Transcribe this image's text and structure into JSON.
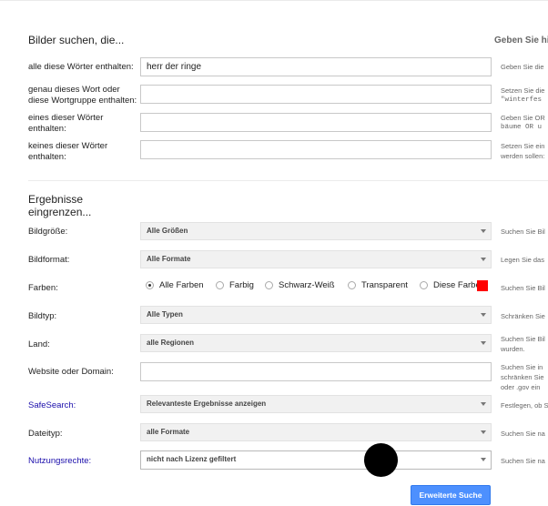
{
  "section_find": {
    "title": "Bilder suchen, die...",
    "hint_header": "Geben Sie hi",
    "rows": [
      {
        "label": "alle diese Wörter enthalten:",
        "value": "herr der ringe",
        "hint_lines": [
          "Geben Sie die"
        ]
      },
      {
        "label": "genau dieses Wort oder diese Wortgruppe enthalten:",
        "value": "",
        "hint_lines": [
          "Setzen Sie die",
          "\"winterfes"
        ]
      },
      {
        "label": "eines dieser Wörter enthalten:",
        "value": "",
        "hint_lines": [
          "Geben Sie OR",
          "bäume OR u"
        ]
      },
      {
        "label": "keines dieser Wörter enthalten:",
        "value": "",
        "hint_lines": [
          "Setzen Sie ein",
          "werden sollen:"
        ]
      }
    ]
  },
  "section_narrow": {
    "title": "Ergebnisse eingrenzen...",
    "bildgroesse": {
      "label": "Bildgröße:",
      "value": "Alle Größen",
      "hint": "Suchen Sie Bil"
    },
    "bildformat": {
      "label": "Bildformat:",
      "value": "Alle Formate",
      "hint": "Legen Sie das"
    },
    "farben": {
      "label": "Farben:",
      "options": [
        "Alle Farben",
        "Farbig",
        "Schwarz-Weiß",
        "Transparent",
        "Diese Farbe"
      ],
      "selected": "Alle Farben",
      "swatch_color": "#ff0000",
      "hint": "Suchen Sie Bil"
    },
    "bildtyp": {
      "label": "Bildtyp:",
      "value": "Alle Typen",
      "hint": "Schränken Sie"
    },
    "land": {
      "label": "Land:",
      "value": "alle Regionen",
      "hint_lines": [
        "Suchen Sie Bil",
        "wurden."
      ]
    },
    "website": {
      "label": "Website oder Domain:",
      "value": "",
      "hint_lines": [
        "Suchen Sie in",
        "schränken Sie",
        "oder .gov ein"
      ]
    },
    "safesearch": {
      "label": "SafeSearch:",
      "value": "Relevanteste Ergebnisse anzeigen",
      "hint": "Festlegen, ob S"
    },
    "dateityp": {
      "label": "Dateityp:",
      "value": "alle Formate",
      "hint": "Suchen Sie na"
    },
    "nutzungsrechte": {
      "label": "Nutzungsrechte:",
      "value": "nicht nach Lizenz gefiltert",
      "hint": "Suchen Sie na"
    }
  },
  "submit_label": "Erweiterte Suche",
  "colors": {
    "link": "#1a0dab",
    "button": "#4d90fe",
    "swatch": "#ff0000"
  }
}
